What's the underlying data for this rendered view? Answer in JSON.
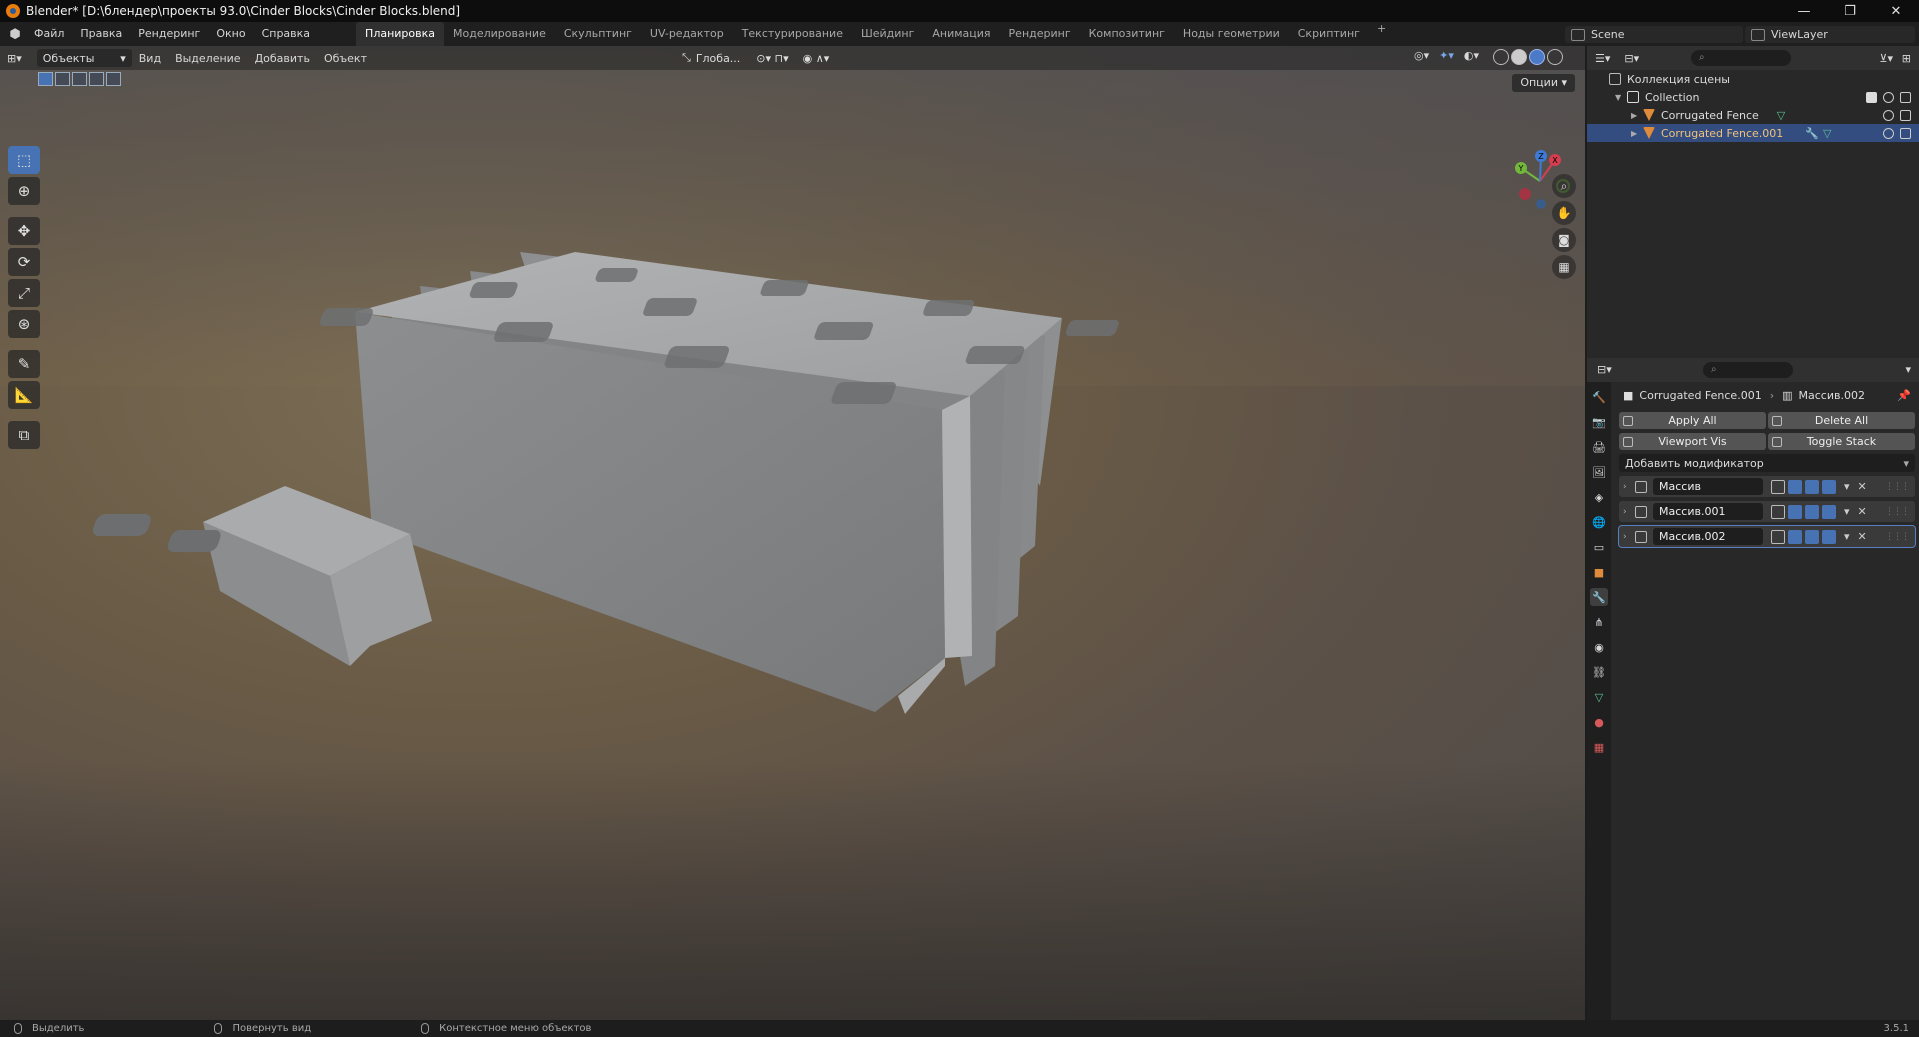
{
  "window": {
    "title": "Blender* [D:\\блендер\\проекты 93.0\\Cinder Blocks\\Cinder Blocks.blend]",
    "minimize": "—",
    "restore": "❐",
    "close": "✕"
  },
  "menu": [
    "Файл",
    "Правка",
    "Рендеринг",
    "Окно",
    "Справка"
  ],
  "workspaces": [
    "Планировка",
    "Моделирование",
    "Скульптинг",
    "UV-редактор",
    "Текстурирование",
    "Шейдинг",
    "Анимация",
    "Рендеринг",
    "Композитинг",
    "Ноды геометрии",
    "Скриптинг"
  ],
  "workspace_add": "+",
  "scene": {
    "label": "Scene"
  },
  "view_layer": {
    "label": "ViewLayer"
  },
  "viewport": {
    "mode": "Объекты",
    "menus": [
      "Вид",
      "Выделение",
      "Добавить",
      "Объект"
    ],
    "orientation": "Глоба...",
    "options": "Опции",
    "gizmo_axes": {
      "x": "X",
      "y": "Y",
      "z": "Z"
    }
  },
  "outliner": {
    "search_placeholder": "⌕",
    "scene_collection": "Коллекция сцены",
    "collection": "Collection",
    "objects": [
      "Corrugated Fence",
      "Corrugated Fence.001"
    ]
  },
  "properties": {
    "search_placeholder": "⌕",
    "breadcrumb_object": "Corrugated Fence.001",
    "breadcrumb_modifier": "Массив.002",
    "apply_all": "Apply All",
    "delete_all": "Delete All",
    "viewport_vis": "Viewport Vis",
    "toggle_stack": "Toggle Stack",
    "add_modifier": "Добавить модификатор",
    "modifiers": [
      "Массив",
      "Массив.001",
      "Массив.002"
    ]
  },
  "statusbar": {
    "select": "Выделить",
    "rotate_view": "Повернуть вид",
    "context_menu": "Контекстное меню объектов",
    "version": "3.5.1"
  },
  "colors": {
    "accent": "#4772b3",
    "selection": "#334d80",
    "concrete": "#9a9b9c"
  }
}
